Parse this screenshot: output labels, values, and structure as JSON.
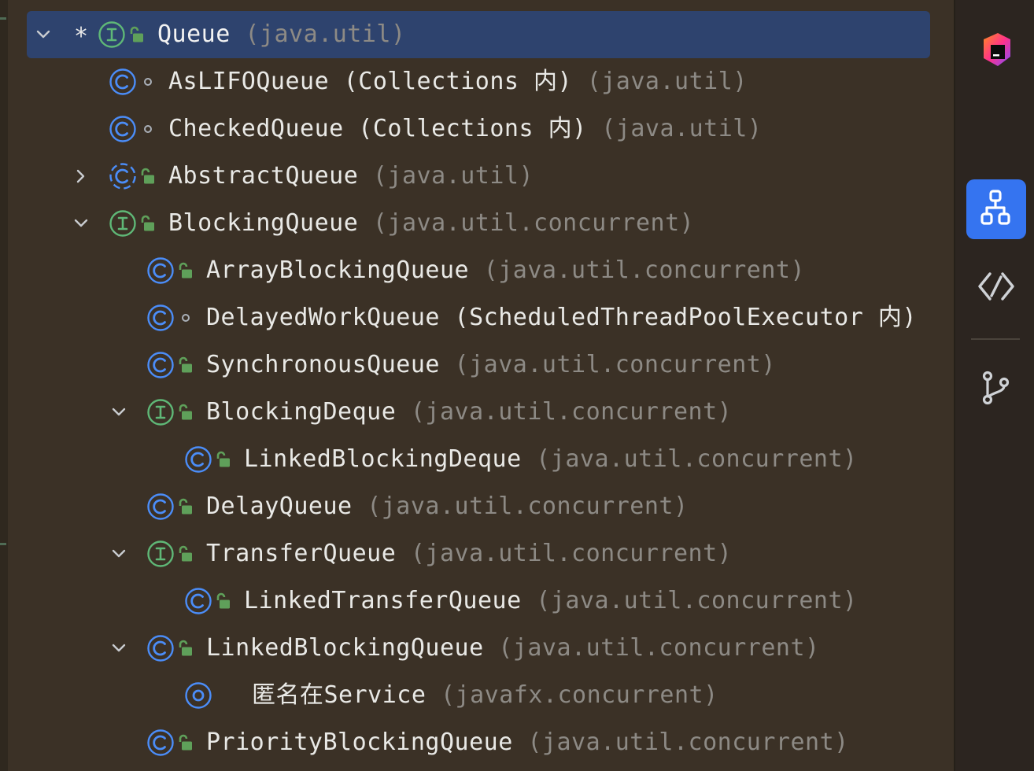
{
  "tree": {
    "rows": [
      {
        "name": "Queue",
        "qualifier": "",
        "pkg": "(java.util)",
        "kind": "interface",
        "modifier": "public",
        "toggle": "expanded",
        "star": "*",
        "selected": true
      },
      {
        "name": "AsLIFOQueue",
        "qualifier": " (Collections 内)",
        "pkg": "(java.util)",
        "kind": "class",
        "modifier": "package",
        "toggle": "none"
      },
      {
        "name": "CheckedQueue",
        "qualifier": " (Collections 内)",
        "pkg": "(java.util)",
        "kind": "class",
        "modifier": "package",
        "toggle": "none"
      },
      {
        "name": "AbstractQueue",
        "qualifier": "",
        "pkg": "(java.util)",
        "kind": "abstract-class",
        "modifier": "public",
        "toggle": "collapsed"
      },
      {
        "name": "BlockingQueue",
        "qualifier": "",
        "pkg": "(java.util.concurrent)",
        "kind": "interface",
        "modifier": "public",
        "toggle": "expanded"
      },
      {
        "name": "ArrayBlockingQueue",
        "qualifier": "",
        "pkg": "(java.util.concurrent)",
        "kind": "class",
        "modifier": "public",
        "toggle": "none"
      },
      {
        "name": "DelayedWorkQueue",
        "qualifier": " (ScheduledThreadPoolExecutor 内)",
        "pkg": "",
        "kind": "class",
        "modifier": "package",
        "toggle": "none"
      },
      {
        "name": "SynchronousQueue",
        "qualifier": "",
        "pkg": "(java.util.concurrent)",
        "kind": "class",
        "modifier": "public",
        "toggle": "none"
      },
      {
        "name": "BlockingDeque",
        "qualifier": "",
        "pkg": "(java.util.concurrent)",
        "kind": "interface",
        "modifier": "public",
        "toggle": "expanded"
      },
      {
        "name": "LinkedBlockingDeque",
        "qualifier": "",
        "pkg": "(java.util.concurrent)",
        "kind": "class",
        "modifier": "public",
        "toggle": "none"
      },
      {
        "name": "DelayQueue",
        "qualifier": "",
        "pkg": "(java.util.concurrent)",
        "kind": "class",
        "modifier": "public",
        "toggle": "none"
      },
      {
        "name": "TransferQueue",
        "qualifier": "",
        "pkg": "(java.util.concurrent)",
        "kind": "interface",
        "modifier": "public",
        "toggle": "expanded"
      },
      {
        "name": "LinkedTransferQueue",
        "qualifier": "",
        "pkg": "(java.util.concurrent)",
        "kind": "class",
        "modifier": "public",
        "toggle": "none"
      },
      {
        "name": "LinkedBlockingQueue",
        "qualifier": "",
        "pkg": "(java.util.concurrent)",
        "kind": "class",
        "modifier": "public",
        "toggle": "expanded"
      },
      {
        "name": "匿名在Service",
        "qualifier": "",
        "pkg": "(javafx.concurrent)",
        "kind": "anonymous-class",
        "modifier": "none",
        "toggle": "none"
      },
      {
        "name": "PriorityBlockingQueue",
        "qualifier": "",
        "pkg": "(java.util.concurrent)",
        "kind": "class",
        "modifier": "public",
        "toggle": "none"
      }
    ]
  },
  "toolwindow_bar": {
    "buttons": [
      {
        "icon": "jetbrains-logo-icon",
        "active": false
      },
      {
        "icon": "hierarchy-icon",
        "active": true
      },
      {
        "icon": "code-icon",
        "active": false
      },
      {
        "icon": "git-branch-icon",
        "active": false
      }
    ]
  },
  "colors": {
    "background": "#3b3126",
    "selection": "#2e436e",
    "class_icon": "#4b8df8",
    "interface_icon": "#5fb877",
    "lock_icon": "#5fa05a",
    "package_text": "#8d8a85",
    "active_tool": "#3574f0"
  }
}
